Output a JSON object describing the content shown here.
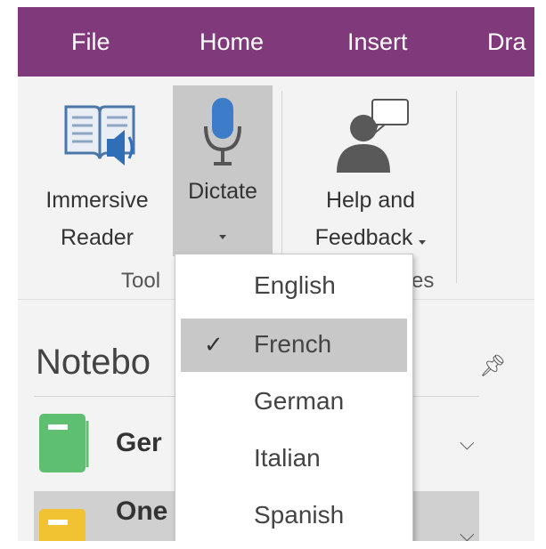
{
  "menu": {
    "items": [
      {
        "label": "File"
      },
      {
        "label": "Home"
      },
      {
        "label": "Insert"
      },
      {
        "label": "Dra"
      }
    ]
  },
  "ribbon": {
    "immersive_reader": {
      "line1": "Immersive",
      "line2": "Reader",
      "icon": "book-speaker-icon"
    },
    "dictate": {
      "label": "Dictate",
      "icon": "microphone-icon"
    },
    "help": {
      "line1": "Help and",
      "line2": "Feedback",
      "icon": "person-speech-icon"
    },
    "groups": {
      "tools": "Tool",
      "help_partial": "es"
    }
  },
  "notebooks": {
    "title": "Notebo",
    "items": [
      {
        "name": "Ger",
        "color": "#5fbf71"
      },
      {
        "name": "One",
        "color": "#f1c232"
      }
    ]
  },
  "dictate_menu": {
    "selected": "French",
    "options": [
      {
        "label": "English",
        "checked": false
      },
      {
        "label": "French",
        "checked": true
      },
      {
        "label": "German",
        "checked": false
      },
      {
        "label": "Italian",
        "checked": false
      },
      {
        "label": "Spanish",
        "checked": false
      }
    ],
    "check_glyph": "✓"
  },
  "colors": {
    "menubar": "#80397b",
    "accent_mic": "#3d7cc9"
  }
}
